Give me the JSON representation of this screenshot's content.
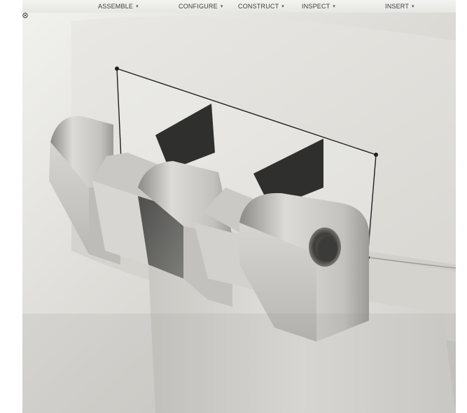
{
  "toolbar": {
    "menus": [
      {
        "label": "ASSEMBLE",
        "caret": "▾"
      },
      {
        "label": "CONFIGURE",
        "caret": "▾"
      },
      {
        "label": "CONSTRUCT",
        "caret": "▾"
      },
      {
        "label": "INSPECT",
        "caret": "▾"
      },
      {
        "label": "INSERT",
        "caret": "▾"
      }
    ]
  },
  "viewport": {
    "model": "hinge-knuckles",
    "icons": [
      "orbit-origin-icon"
    ],
    "colors": {
      "background": "#dcdbd6",
      "body": "#d8d6d1",
      "knuckle_light": "#d9d8d4",
      "knuckle_dark": "#6f6f6c",
      "sketch_line": "#1e1e1e"
    }
  }
}
